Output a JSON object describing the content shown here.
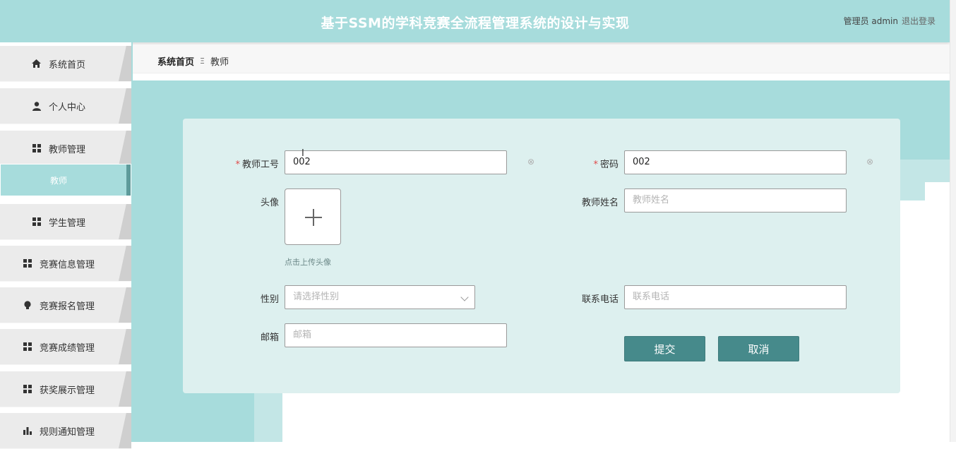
{
  "header": {
    "title": "基于SSM的学科竞赛全流程管理系统的设计与实现",
    "user_label": "管理员 admin",
    "logout_label": "退出登录"
  },
  "sidebar": {
    "items": [
      {
        "label": "系统首页",
        "icon": "home-icon"
      },
      {
        "label": "个人中心",
        "icon": "user-icon"
      },
      {
        "label": "教师管理",
        "icon": "grid-icon"
      },
      {
        "label": "教师",
        "icon": ""
      },
      {
        "label": "学生管理",
        "icon": "grid-icon"
      },
      {
        "label": "竞赛信息管理",
        "icon": "grid-icon"
      },
      {
        "label": "竞赛报名管理",
        "icon": "bulb-icon"
      },
      {
        "label": "竞赛成绩管理",
        "icon": "grid-icon"
      },
      {
        "label": "获奖展示管理",
        "icon": "grid-icon"
      },
      {
        "label": "规则通知管理",
        "icon": "bar-chart-icon"
      }
    ]
  },
  "breadcrumb": {
    "home": "系统首页",
    "separator": "Ξ",
    "current": "教师"
  },
  "form": {
    "teacher_id": {
      "label": "教师工号",
      "value": "002"
    },
    "password": {
      "label": "密码",
      "value": "002"
    },
    "avatar": {
      "label": "头像",
      "hint": "点击上传头像"
    },
    "teacher_name": {
      "label": "教师姓名",
      "placeholder": "教师姓名"
    },
    "gender": {
      "label": "性别",
      "placeholder": "请选择性别"
    },
    "phone": {
      "label": "联系电话",
      "placeholder": "联系电话"
    },
    "email": {
      "label": "邮箱",
      "placeholder": "邮箱"
    },
    "submit_label": "提交",
    "cancel_label": "取消"
  },
  "colors": {
    "accent": "#a7dcdc",
    "button": "#468a8b",
    "required": "#e04a4a"
  }
}
